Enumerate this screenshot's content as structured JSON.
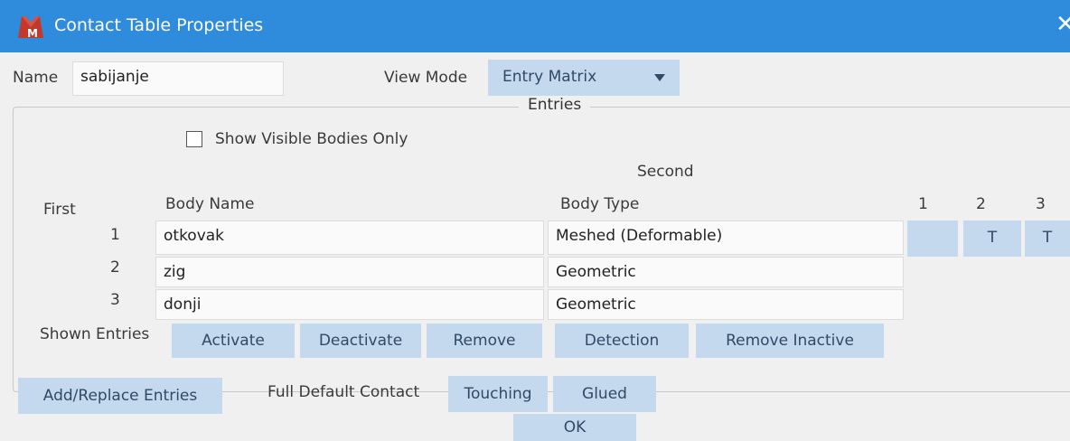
{
  "window": {
    "title": "Contact Table Properties",
    "close_glyph": "✕"
  },
  "form": {
    "name_label": "Name",
    "name_value": "sabijanje",
    "view_mode_label": "View Mode",
    "view_mode_value": "Entry Matrix"
  },
  "entries": {
    "group_title": "Entries",
    "show_visible_label": "Show Visible Bodies Only",
    "second_label": "Second",
    "first_label": "First",
    "col_body_name": "Body Name",
    "col_body_type": "Body Type",
    "matrix_cols": [
      "1",
      "2",
      "3"
    ],
    "rows": [
      {
        "index": "1",
        "name": "otkovak",
        "type": "Meshed (Deformable)",
        "cells": [
          "",
          "T",
          "T"
        ]
      },
      {
        "index": "2",
        "name": "zig",
        "type": "Geometric"
      },
      {
        "index": "3",
        "name": "donji",
        "type": "Geometric"
      }
    ],
    "shown_entries_label": "Shown Entries",
    "buttons": {
      "activate": "Activate",
      "deactivate": "Deactivate",
      "remove": "Remove",
      "detection": "Detection",
      "remove_inactive": "Remove Inactive"
    }
  },
  "footer": {
    "add_replace": "Add/Replace Entries",
    "full_default_label": "Full Default Contact",
    "touching": "Touching",
    "glued": "Glued",
    "ok": "OK"
  },
  "colors": {
    "titlebar": "#2f8bdc",
    "button": "#c5d9ee",
    "background": "#f0f0f0"
  }
}
